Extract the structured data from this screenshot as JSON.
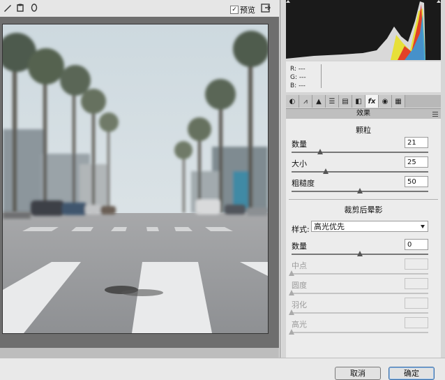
{
  "toolbar": {
    "tools": [
      "brush-icon",
      "cylinder-icon",
      "ellipse-icon"
    ],
    "preview_checked": "✓",
    "preview_label": "预览",
    "fullscreen_icon": "fullscreen-icon"
  },
  "rgb": {
    "r": "R:  ---",
    "g": "G:  ---",
    "b": "B:  ---"
  },
  "tabs": [
    "◐",
    "⩘",
    "▲",
    "☰",
    "▤",
    "◧",
    "fx",
    "◉",
    "▦"
  ],
  "active_tab": 6,
  "panel": {
    "section_title": "效果",
    "grain": {
      "title": "颗粒",
      "rows": [
        {
          "label": "数量",
          "value": "21",
          "level": 0.21
        },
        {
          "label": "大小",
          "value": "25",
          "level": 0.25
        },
        {
          "label": "粗糙度",
          "value": "50",
          "level": 0.5
        }
      ]
    },
    "vignette": {
      "title": "裁剪后晕影",
      "style_label": "样式:",
      "style_value": "高光优先",
      "amount": {
        "label": "数量",
        "value": "0",
        "level": 0.5
      },
      "disabled_rows": [
        {
          "label": "中点"
        },
        {
          "label": "圆度"
        },
        {
          "label": "羽化"
        },
        {
          "label": "高光"
        }
      ]
    }
  },
  "footer": {
    "cancel_label": "取消",
    "ok_label": "确定"
  },
  "colors": {
    "accent": "#3a6ea5"
  }
}
